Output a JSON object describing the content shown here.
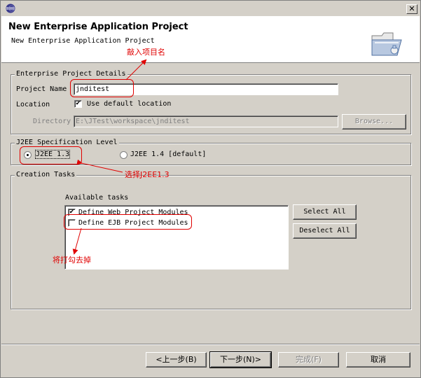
{
  "window": {
    "app_icon": "eclipse-icon",
    "close_glyph": "✕"
  },
  "header": {
    "title": "New Enterprise Application Project",
    "description": "New Enterprise Application Project",
    "banner_icon": "folder-wizard-icon"
  },
  "project_details": {
    "group_label": "Enterprise Project Details",
    "project_name_label": "Project Name",
    "project_name_value": "jnditest",
    "location_label": "Location",
    "use_default_label": "Use default location",
    "use_default_checked": true,
    "directory_label": "Directory",
    "directory_value": "E:\\JTest\\workspace\\jnditest",
    "browse_label": "Browse..."
  },
  "spec_level": {
    "group_label": "J2EE Specification Level",
    "option_13": "J2EE 1.3",
    "option_14": "J2EE 1.4 [default]",
    "selected": "J2EE 1.3"
  },
  "creation_tasks": {
    "group_label": "Creation Tasks",
    "available_label": "Available tasks",
    "tasks": [
      {
        "label": "Define Web Project Modules",
        "checked": true
      },
      {
        "label": "Define EJB Project Modules",
        "checked": false
      }
    ],
    "select_all": "Select All",
    "deselect_all": "Deselect All"
  },
  "footer": {
    "back": "<上一步(B)",
    "next": "下一步(N)>",
    "finish": "完成(F)",
    "cancel": "取消"
  },
  "annotations": {
    "project_name_note": "敲入项目名",
    "spec_note": "选择J2EE1.3",
    "ejb_note": "将打勾去掉",
    "color": "#e00000"
  }
}
